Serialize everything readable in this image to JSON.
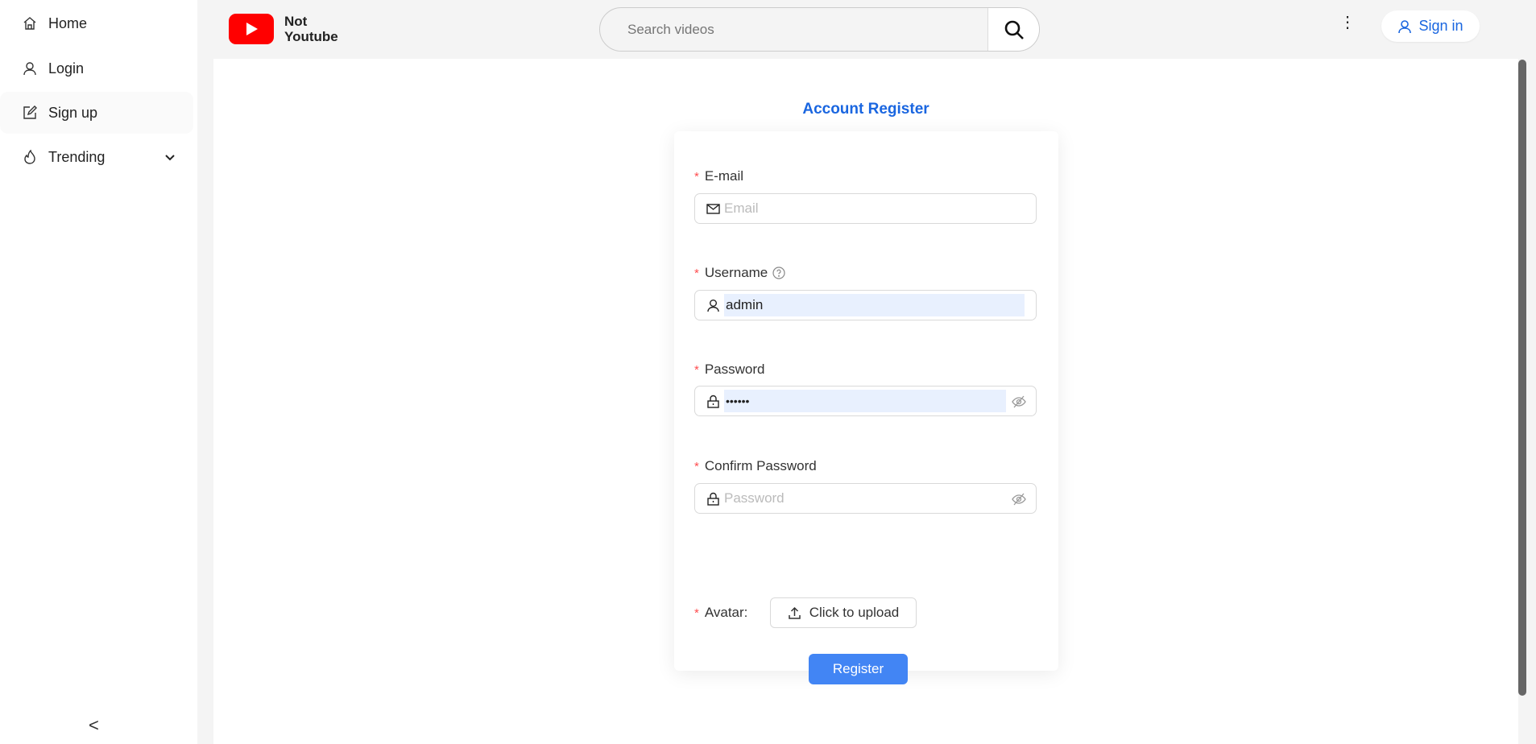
{
  "sidebar": {
    "items": [
      {
        "label": "Home",
        "icon": "home-icon"
      },
      {
        "label": "Login",
        "icon": "user-icon"
      },
      {
        "label": "Sign up",
        "icon": "edit-icon",
        "active": true
      },
      {
        "label": "Trending",
        "icon": "fire-icon",
        "expandable": true
      }
    ],
    "collapse": "<"
  },
  "header": {
    "logo_line1": "Not",
    "logo_line2": "Youtube",
    "search_placeholder": "Search videos",
    "more": "⋮",
    "signin": "Sign in"
  },
  "form": {
    "title": "Account Register",
    "email": {
      "label": "E-mail",
      "placeholder": "Email",
      "value": ""
    },
    "username": {
      "label": "Username",
      "value": "admin"
    },
    "password": {
      "label": "Password",
      "value": "••••••"
    },
    "confirm": {
      "label": "Confirm Password",
      "placeholder": "Password"
    },
    "avatar": {
      "label": "Avatar:",
      "button": "Click to upload"
    },
    "submit": "Register"
  },
  "colors": {
    "accent": "#1a66e0",
    "button": "#4285f4",
    "required": "#ff4d4f",
    "logo": "#ff0000"
  }
}
